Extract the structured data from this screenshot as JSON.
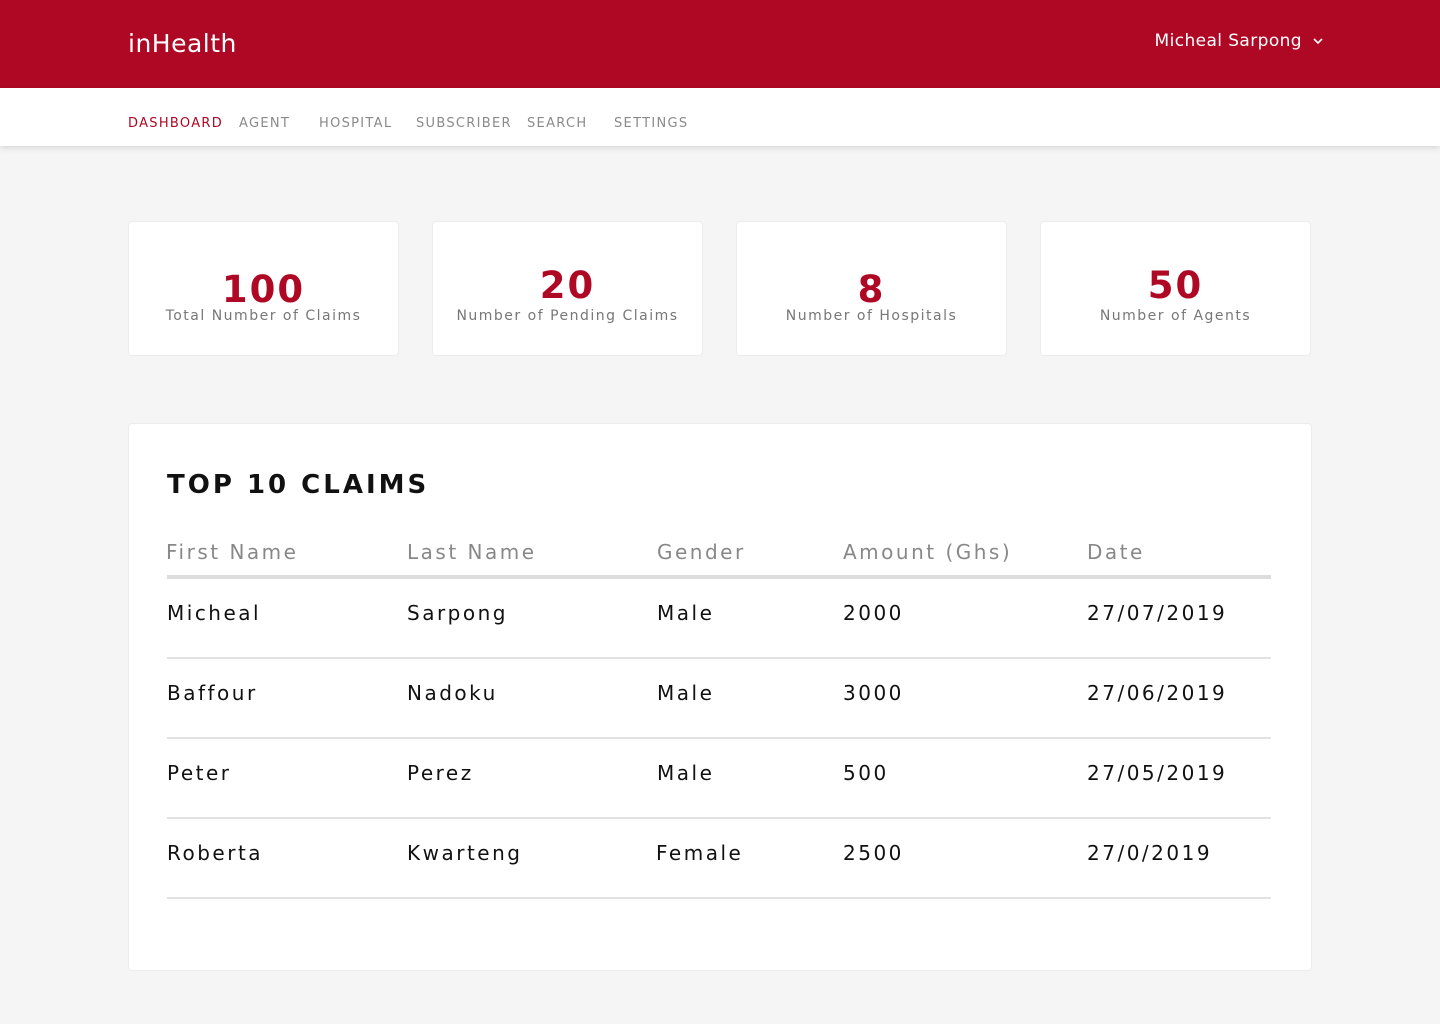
{
  "app": {
    "brand": "inHealth",
    "user_name": "Micheal Sarpong",
    "accent_color": "#ae0824"
  },
  "nav": {
    "items": [
      "DASHBOARD",
      "AGENT",
      "HOSPITAL",
      "SUBSCRIBER",
      "SEARCH",
      "SETTINGS"
    ],
    "active": "DASHBOARD"
  },
  "stats": [
    {
      "value": "100",
      "label": "Total Number of Claims"
    },
    {
      "value": "20",
      "label": "Number of Pending Claims"
    },
    {
      "value": "8",
      "label": "Number of Hospitals"
    },
    {
      "value": "50",
      "label": "Number of Agents"
    }
  ],
  "claims": {
    "title": "TOP 10 CLAIMS",
    "columns": [
      "First Name",
      "Last Name",
      "Gender",
      "Amount (Ghs)",
      "Date"
    ],
    "rows": [
      [
        "Micheal",
        "Sarpong",
        "Male",
        "2000",
        "27/07/2019"
      ],
      [
        "Baffour",
        "Nadoku",
        "Male",
        "3000",
        "27/06/2019"
      ],
      [
        "Peter",
        "Perez",
        "Male",
        "500",
        "27/05/2019"
      ],
      [
        "Roberta",
        "Kwarteng",
        "Female",
        "2500",
        "27/0/2019"
      ]
    ]
  }
}
